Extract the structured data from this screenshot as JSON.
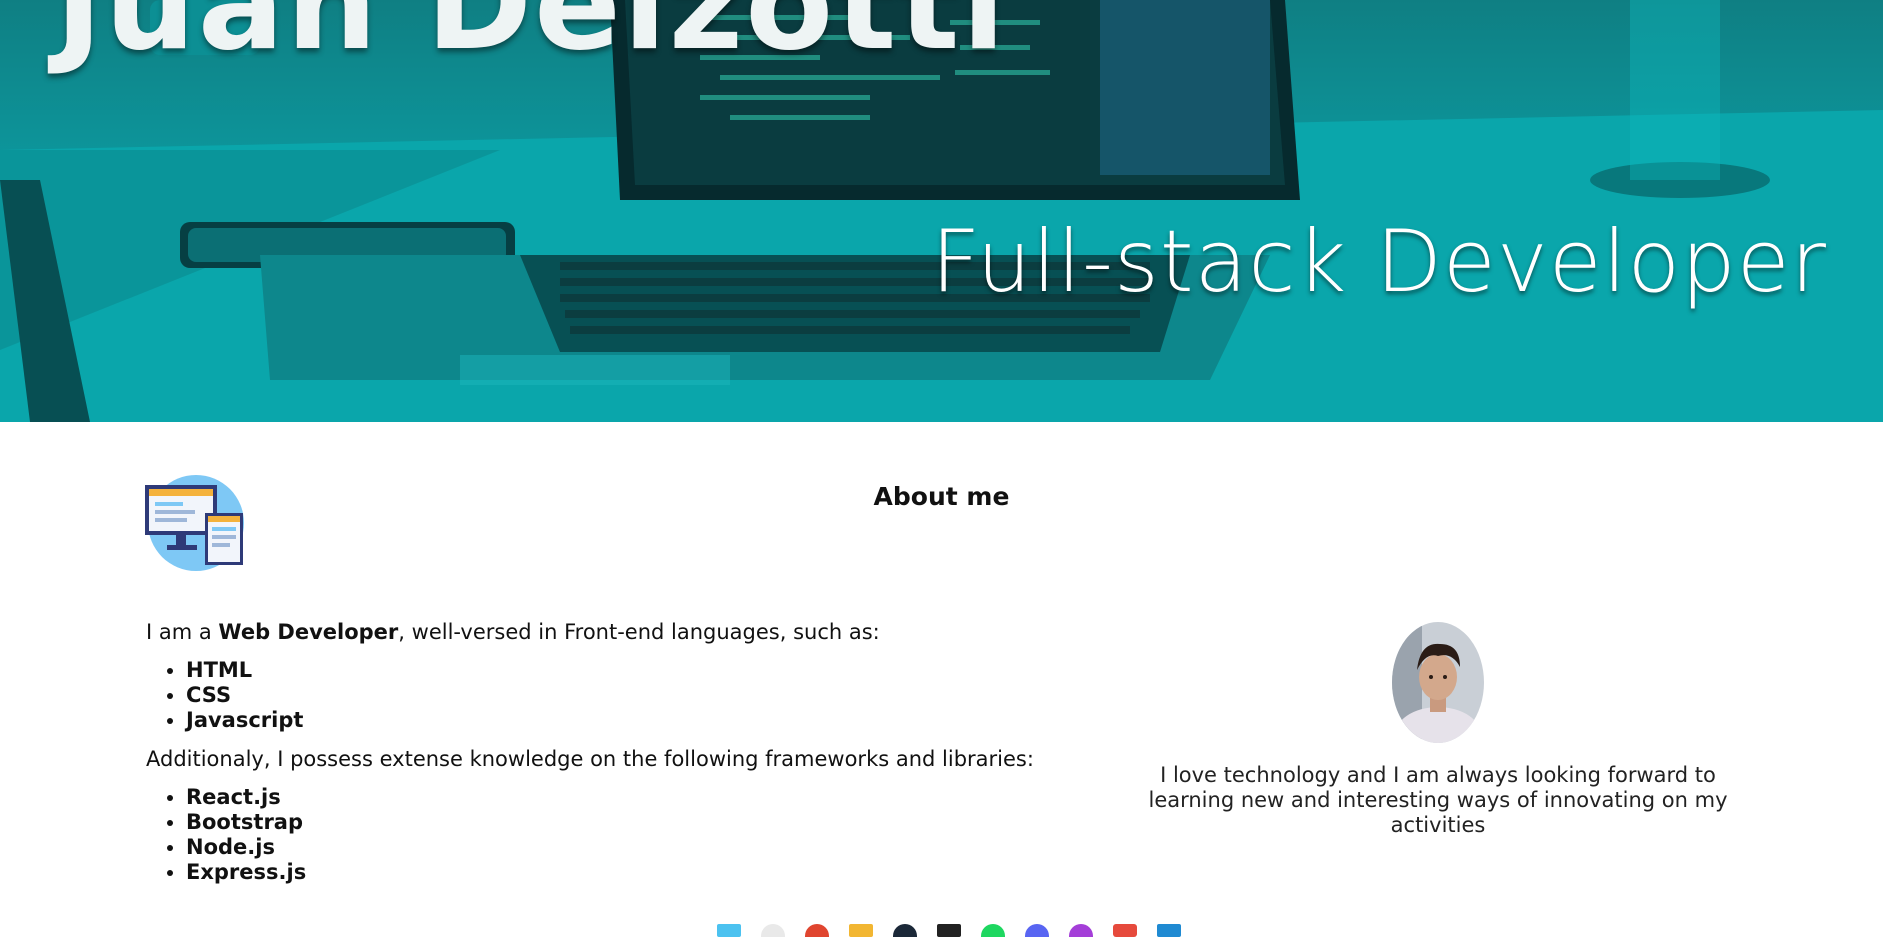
{
  "hero": {
    "name": "Juan Delzotti",
    "subtitle": "Full-stack Developer"
  },
  "about": {
    "title": "About me",
    "intro_prefix": "I am a ",
    "intro_strong": "Web Developer",
    "intro_suffix": ", well-versed in Front-end languages, such as:",
    "languages": [
      "HTML",
      "CSS",
      "Javascript"
    ],
    "frameworks_intro": "Additionaly, I possess extense knowledge on the following frameworks and libraries:",
    "frameworks": [
      "React.js",
      "Bootstrap",
      "Node.js",
      "Express.js"
    ],
    "bio": "I love technology and I am always looking forward to learning new and interesting ways of innovating on my activities"
  },
  "icons": {
    "about_icon": "web-devices-icon",
    "avatar": "profile-photo"
  },
  "colors": {
    "hero_teal": "#0c9aa0",
    "text": "#111111"
  },
  "taskbar": [
    "windows-icon",
    "search-icon",
    "chrome-icon",
    "folder-icon",
    "steam-icon",
    "epic-icon",
    "spotify-icon",
    "discord-icon",
    "podcast-icon",
    "calendar-icon",
    "vscode-icon"
  ]
}
